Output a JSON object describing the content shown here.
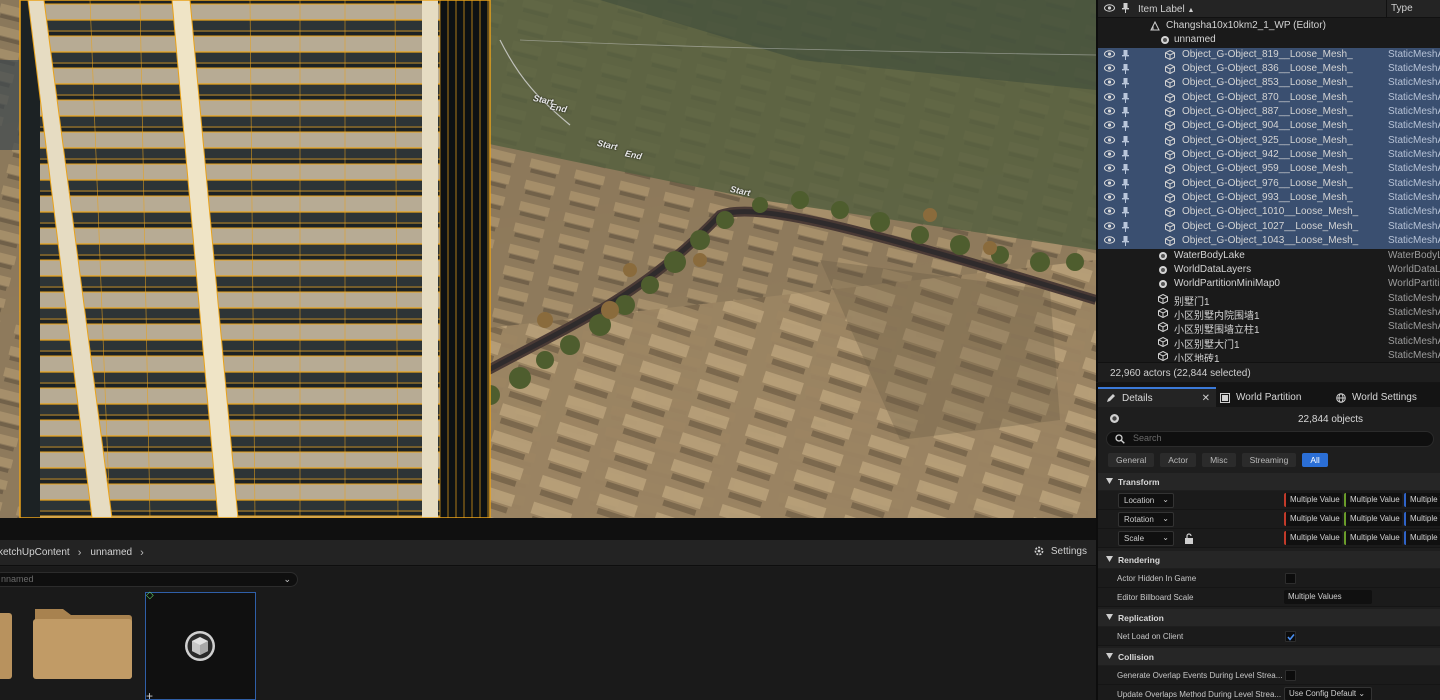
{
  "viewport": {
    "labels": [
      {
        "text": "Start",
        "id": "start-1"
      },
      {
        "text": "End",
        "id": "end-1"
      },
      {
        "text": "Start",
        "id": "start-2"
      },
      {
        "text": "End",
        "id": "end-2"
      },
      {
        "text": "Start",
        "id": "start-3"
      }
    ]
  },
  "content_browser": {
    "breadcrumb": [
      "ketchUpContent",
      "unnamed"
    ],
    "settings_label": "Settings",
    "path_value": "nnamed"
  },
  "outliner": {
    "header": {
      "label": "Item Label",
      "sort": "▲",
      "type": "Type"
    },
    "world": {
      "label": "Changsha10x10km2_1_WP (Editor)"
    },
    "root": {
      "label": "unnamed"
    },
    "selected_items": [
      {
        "label": "Object_G-Object_819__Loose_Mesh_",
        "type": "StaticMeshA"
      },
      {
        "label": "Object_G-Object_836__Loose_Mesh_",
        "type": "StaticMeshA"
      },
      {
        "label": "Object_G-Object_853__Loose_Mesh_",
        "type": "StaticMeshA"
      },
      {
        "label": "Object_G-Object_870__Loose_Mesh_",
        "type": "StaticMeshA"
      },
      {
        "label": "Object_G-Object_887__Loose_Mesh_",
        "type": "StaticMeshA"
      },
      {
        "label": "Object_G-Object_904__Loose_Mesh_",
        "type": "StaticMeshA"
      },
      {
        "label": "Object_G-Object_925__Loose_Mesh_",
        "type": "StaticMeshA"
      },
      {
        "label": "Object_G-Object_942__Loose_Mesh_",
        "type": "StaticMeshA"
      },
      {
        "label": "Object_G-Object_959__Loose_Mesh_",
        "type": "StaticMeshA"
      },
      {
        "label": "Object_G-Object_976__Loose_Mesh_",
        "type": "StaticMeshA"
      },
      {
        "label": "Object_G-Object_993__Loose_Mesh_",
        "type": "StaticMeshA"
      },
      {
        "label": "Object_G-Object_1010__Loose_Mesh_",
        "type": "StaticMeshA"
      },
      {
        "label": "Object_G-Object_1027__Loose_Mesh_",
        "type": "StaticMeshA"
      },
      {
        "label": "Object_G-Object_1043__Loose_Mesh_",
        "type": "StaticMeshA"
      }
    ],
    "other_items": [
      {
        "label": "WaterBodyLake",
        "type": "WaterBodyL",
        "icon": "water-body-icon"
      },
      {
        "label": "WorldDataLayers",
        "type": "WorldDataLa",
        "icon": "world-data-layers-icon"
      },
      {
        "label": "WorldPartitionMiniMap0",
        "type": "WorldPartiti",
        "icon": "world-partition-minimap-icon"
      },
      {
        "label": "别墅门1",
        "type": "StaticMeshA",
        "icon": "static-mesh-icon"
      },
      {
        "label": "小区别墅内院围墙1",
        "type": "StaticMeshA",
        "icon": "static-mesh-icon"
      },
      {
        "label": "小区别墅围墙立柱1",
        "type": "StaticMeshA",
        "icon": "static-mesh-icon"
      },
      {
        "label": "小区别墅大门1",
        "type": "StaticMeshA",
        "icon": "static-mesh-icon"
      },
      {
        "label": "小区地砖1",
        "type": "StaticMeshA",
        "icon": "static-mesh-icon"
      }
    ],
    "status": "22,960 actors (22,844 selected)"
  },
  "details": {
    "tabs": [
      {
        "label": "Details",
        "icon": "pencil-icon"
      },
      {
        "label": "World Partition",
        "icon": "world-partition-icon"
      },
      {
        "label": "World Settings",
        "icon": "globe-icon"
      }
    ],
    "objects_count": "22,844 objects",
    "search_placeholder": "Search",
    "filters": [
      "General",
      "Actor",
      "Misc",
      "Streaming",
      "All"
    ],
    "active_filter": "All",
    "sections": {
      "transform": "Transform",
      "rendering": "Rendering",
      "replication": "Replication",
      "collision": "Collision"
    },
    "transform": {
      "location": "Location",
      "rotation": "Rotation",
      "scale": "Scale",
      "multiple_value": "Multiple Value"
    },
    "rendering": {
      "actor_hidden": "Actor Hidden In Game",
      "actor_hidden_checked": false,
      "billboard_scale": "Editor Billboard Scale",
      "billboard_value": "Multiple Values"
    },
    "replication": {
      "net_load": "Net Load on Client",
      "net_load_checked": true
    },
    "collision": {
      "generate_overlap": "Generate Overlap Events During Level Strea...",
      "generate_overlap_checked": false,
      "update_overlaps": "Update Overlaps Method During Level Strea...",
      "update_overlaps_value": "Use Config Default"
    }
  },
  "colors": {
    "accent": "#2b6fd6",
    "selection": "#3a4f70",
    "building_wireframe": "#e9a21a",
    "axis_x": "#c33a2a",
    "axis_y": "#6a9d2a",
    "axis_z": "#2f63c9"
  }
}
